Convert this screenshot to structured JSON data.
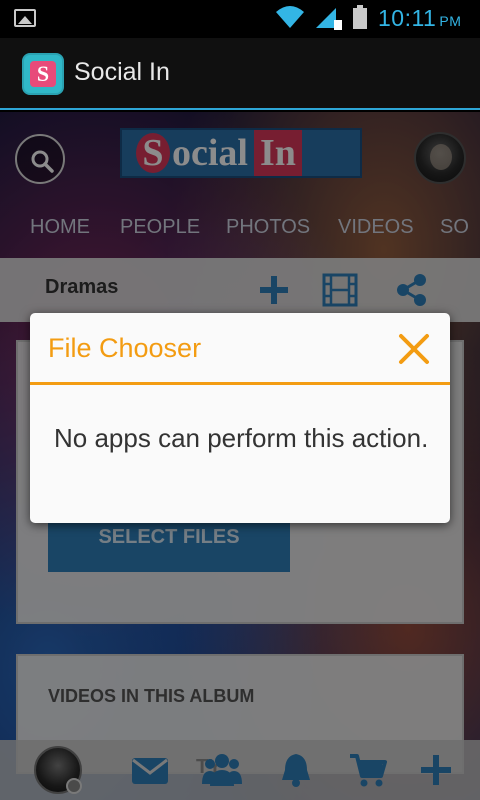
{
  "status_bar": {
    "time": "10:11",
    "ampm": "PM",
    "icons": [
      "picture-icon",
      "wifi-icon",
      "signal-icon",
      "battery-icon"
    ],
    "accent": "#33b5e5"
  },
  "action_bar": {
    "app_icon_letter": "S",
    "title": "Social In"
  },
  "site_header": {
    "logo_s": "S",
    "logo_mid": "ocial",
    "logo_in": "In"
  },
  "nav": {
    "items": [
      "HOME",
      "PEOPLE",
      "PHOTOS",
      "VIDEOS",
      "SO"
    ]
  },
  "album_bar": {
    "title": "Dramas",
    "icons": [
      "plus-icon",
      "film-icon",
      "share-icon"
    ]
  },
  "upload_card": {
    "button_label": "SELECT FILES"
  },
  "videos_card": {
    "label": "VIDEOS IN THIS ALBUM"
  },
  "bottom_bar": {
    "icons": [
      "mail-icon",
      "people-icon",
      "bell-icon",
      "cart-icon",
      "plus-icon"
    ],
    "ghost_text": "TY"
  },
  "dialog": {
    "title": "File Chooser",
    "message": "No apps can perform this action.",
    "accent": "#f39c12"
  }
}
